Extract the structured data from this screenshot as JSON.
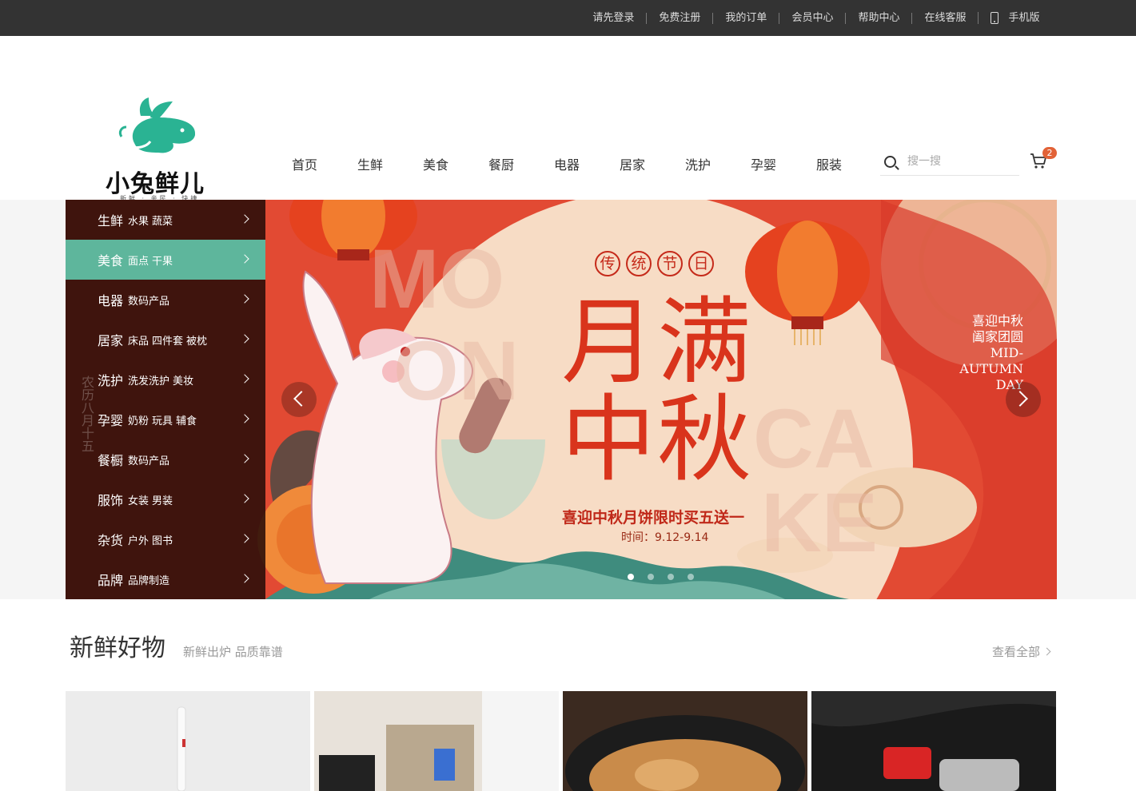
{
  "topbar": {
    "links": [
      "请先登录",
      "免费注册",
      "我的订单",
      "会员中心",
      "帮助中心",
      "在线客服"
    ],
    "mobile": "手机版"
  },
  "logo": {
    "text": "小兔鲜儿",
    "tagline": "新鲜 · 亲民 · 快捷"
  },
  "nav": [
    "首页",
    "生鲜",
    "美食",
    "餐厨",
    "电器",
    "居家",
    "洗护",
    "孕婴",
    "服装"
  ],
  "search": {
    "placeholder": "搜一搜"
  },
  "cart": {
    "count": "2"
  },
  "categories": [
    {
      "main": "生鲜",
      "subs": [
        "水果",
        "蔬菜"
      ]
    },
    {
      "main": "美食",
      "subs": [
        "面点",
        "干果"
      ]
    },
    {
      "main": "电器",
      "subs": [
        "数码产品"
      ]
    },
    {
      "main": "居家",
      "subs": [
        "床品",
        "四件套",
        "被枕"
      ]
    },
    {
      "main": "洗护",
      "subs": [
        "洗发洗护",
        "美妆"
      ]
    },
    {
      "main": "孕婴",
      "subs": [
        "奶粉",
        "玩具",
        "辅食"
      ]
    },
    {
      "main": "餐橱",
      "subs": [
        "数码产品"
      ]
    },
    {
      "main": "服饰",
      "subs": [
        "女装",
        "男装"
      ]
    },
    {
      "main": "杂货",
      "subs": [
        "户外",
        "图书"
      ]
    },
    {
      "main": "品牌",
      "subs": [
        "品牌制造"
      ]
    }
  ],
  "active_category": 1,
  "banner": {
    "tag": [
      "传",
      "统",
      "节",
      "日"
    ],
    "title_line1": "月满",
    "title_line2": "中秋",
    "promo": "喜迎中秋月饼限时买五送一",
    "time": "时间：9.12-9.14",
    "right_text": "喜迎中秋 阖家团圆 MID-AUTUMN DAY",
    "vertical_text": "农历八月十五",
    "bg_letters": "MOON CAKE",
    "slides": 4,
    "current_slide": 1
  },
  "section": {
    "title": "新鲜好物",
    "subtitle": "新鲜出炉 品质靠谱",
    "more": "查看全部"
  },
  "colors": {
    "accent": "#5eb69c",
    "topbar": "#333333",
    "banner_red": "#e24a33",
    "badge": "#e26237"
  }
}
